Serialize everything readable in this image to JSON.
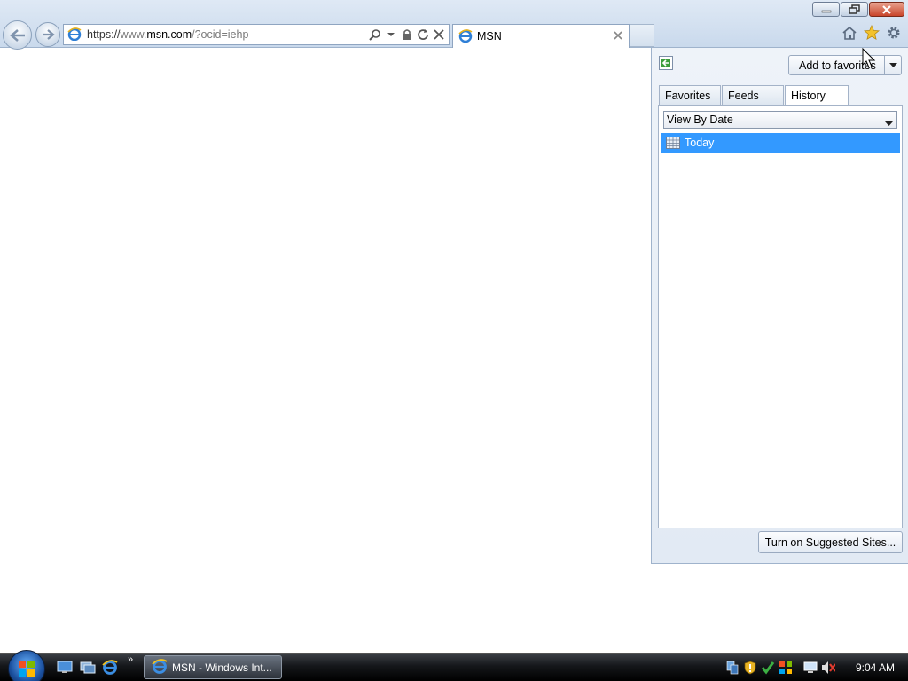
{
  "window": {
    "minimize_icon": "minimize-icon",
    "restore_icon": "restore-icon",
    "close_icon": "close-icon"
  },
  "navigation": {
    "back_icon": "back-arrow-icon",
    "forward_icon": "forward-arrow-icon",
    "address": {
      "scheme": "https://",
      "host_prefix": "www.",
      "host": "msn.com",
      "path": "/?ocid=iehp",
      "icons": [
        "search-icon",
        "dropdown-icon",
        "lock-icon",
        "refresh-icon",
        "stop-icon"
      ]
    }
  },
  "tabs": [
    {
      "title": "MSN",
      "icon": "ie-icon",
      "active": true
    }
  ],
  "command_icons": [
    "home-icon",
    "favorites-star-icon",
    "tools-gear-icon"
  ],
  "favorites_center": {
    "add_button": "Add to favorites",
    "tabs": [
      "Favorites",
      "Feeds",
      "History"
    ],
    "active_tab": "History",
    "view_select": "View By Date",
    "history_items": [
      {
        "label": "Today",
        "icon": "calendar-icon",
        "selected": true
      }
    ],
    "suggest_button": "Turn on Suggested Sites..."
  },
  "taskbar": {
    "start": "start-orb-icon",
    "quick_launch": [
      "show-desktop-icon",
      "switch-windows-icon",
      "ie-icon"
    ],
    "more": "»",
    "task_button": "MSN - Windows Int...",
    "tray_icons": [
      "network-icon",
      "security-shield-icon",
      "update-icon",
      "sync-icon",
      "display-icon",
      "volume-muted-icon"
    ],
    "clock": "9:04 AM"
  },
  "colors": {
    "selection": "#3399ff",
    "chrome": "#dfe9f5",
    "taskbar": "#15171a"
  }
}
